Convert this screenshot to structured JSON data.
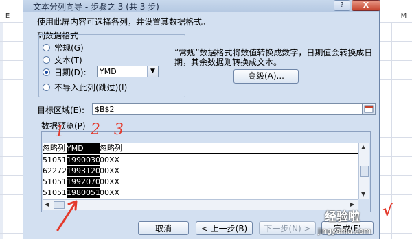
{
  "spreadsheet": {
    "col_left": "E",
    "col_right": "M"
  },
  "dialog": {
    "title": "文本分列向导 - 步骤之 3 (共 3 步)",
    "help_label": "?",
    "close_label": "X",
    "intro": "使用此屏内容可选择各列，并设置其数据格式。",
    "group_label": "列数据格式",
    "radio_options": [
      {
        "label": "常规(G)",
        "selected": false
      },
      {
        "label": "文本(T)",
        "selected": false
      },
      {
        "label": "日期(D):",
        "selected": true
      },
      {
        "label": "不导入此列(跳过)(I)",
        "selected": false
      }
    ],
    "date_format": "YMD",
    "description": "“常规”数据格式将数值转换成数字，日期值会转换成日期，其余数据则转换成文本。",
    "advanced_button": "高级(A)...",
    "target_label": "目标区域(E):",
    "target_value": "$B$2",
    "preview_label": "数据预览(P)",
    "preview": {
      "headers": [
        "忽略列",
        "YMD",
        "忽略列"
      ],
      "rows": [
        [
          "510512",
          "19900306",
          "00XX"
        ],
        [
          "622721",
          "19931204",
          "00XX"
        ],
        [
          "510512",
          "19920706",
          "00XX"
        ],
        [
          "510512",
          "19800515",
          "00XX"
        ]
      ]
    },
    "buttons": {
      "cancel": "取消",
      "back": "< 上一步(B)",
      "next": "下一步(N) >",
      "finish": "完成(F)"
    }
  },
  "annotations": {
    "numbers": [
      "1",
      "2",
      "3"
    ],
    "arrow_color": "#e43a2c",
    "watermark": "经验啦",
    "watermark_check": "√",
    "watermark_url": "jingyanla.com"
  },
  "colors": {
    "dialog_bg": "#d3e0f1",
    "close_button": "#c4432d",
    "selection": "#000000"
  }
}
